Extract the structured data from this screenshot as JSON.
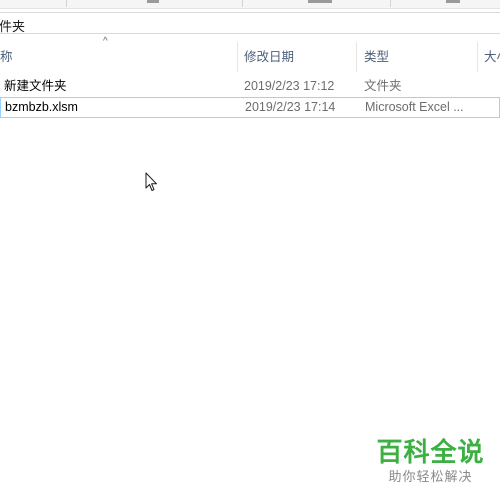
{
  "address_bar": {
    "path_text": "件夹"
  },
  "columns": {
    "name_label": "称",
    "date_label": "修改日期",
    "type_label": "类型",
    "size_label": "大小",
    "sort_icon": "sort-ascending-icon"
  },
  "files": [
    {
      "name": "新建文件夹",
      "modified": "2019/2/23 17:12",
      "type": "文件夹",
      "selected": false
    },
    {
      "name": "bzmbzb.xlsm",
      "modified": "2019/2/23 17:14",
      "type": "Microsoft Excel ...",
      "selected": true
    }
  ],
  "cursor": {
    "icon": "arrow-cursor-icon"
  },
  "watermark": {
    "title": "百科全说",
    "subtitle": "助你轻松解决"
  },
  "colors": {
    "header_text": "#4c607a",
    "selection_border": "#99d1ff",
    "watermark_green": "#3cb043"
  }
}
